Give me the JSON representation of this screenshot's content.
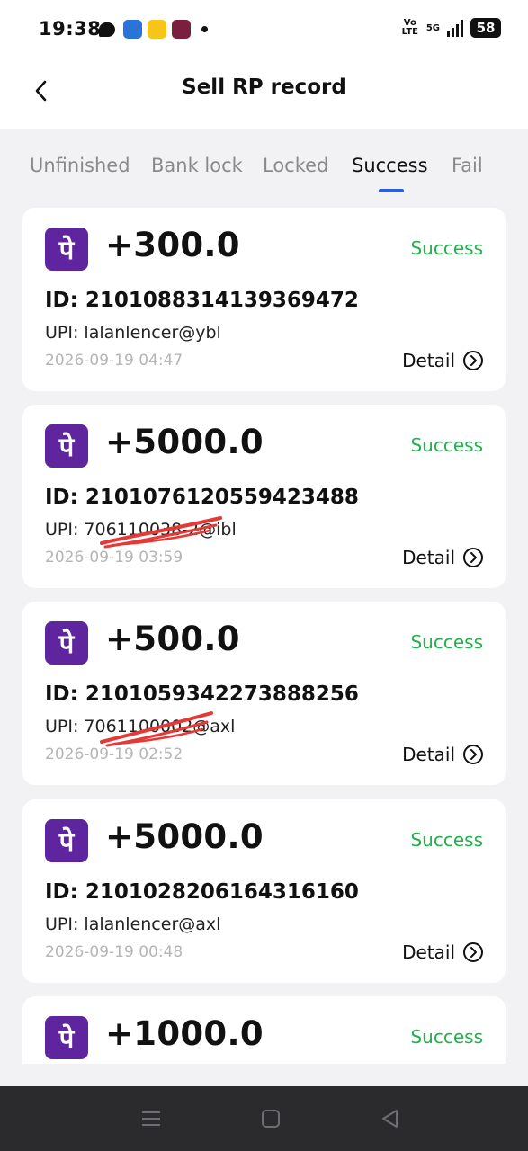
{
  "status_bar": {
    "time": "19:38",
    "network_label": "Vo LTE",
    "net_5g": "5G",
    "battery": "58"
  },
  "header": {
    "title": "Sell RP record"
  },
  "tabs": [
    {
      "label": "Unfinished",
      "active": false
    },
    {
      "label": "Bank lock",
      "active": false
    },
    {
      "label": "Locked",
      "active": false
    },
    {
      "label": "Success",
      "active": true
    },
    {
      "label": "Fail",
      "active": false
    }
  ],
  "colors": {
    "accent": "#2b5fd6",
    "success": "#22b14c",
    "phonepe": "#5f259f",
    "scribble": "#e53935"
  },
  "records": [
    {
      "icon": "phonepe-icon",
      "icon_glyph": "पे",
      "amount": "+300.0",
      "status": "Success",
      "id": "ID: 2101088314139369472",
      "upi": "UPI: lalanlencer@ybl",
      "date": "2026-09-19 04:47",
      "detail_label": "Detail",
      "redacted": false
    },
    {
      "icon": "phonepe-icon",
      "icon_glyph": "पे",
      "amount": "+5000.0",
      "status": "Success",
      "id": "ID: 2101076120559423488",
      "upi": "UPI: 706110038-2@ibl",
      "date": "2026-09-19 03:59",
      "detail_label": "Detail",
      "redacted": true
    },
    {
      "icon": "phonepe-icon",
      "icon_glyph": "पे",
      "amount": "+500.0",
      "status": "Success",
      "id": "ID: 2101059342273888256",
      "upi": "UPI: 7061100002@axl",
      "date": "2026-09-19 02:52",
      "detail_label": "Detail",
      "redacted": true
    },
    {
      "icon": "phonepe-icon",
      "icon_glyph": "पे",
      "amount": "+5000.0",
      "status": "Success",
      "id": "ID: 2101028206164316160",
      "upi": "UPI: lalanlencer@axl",
      "date": "2026-09-19 00:48",
      "detail_label": "Detail",
      "redacted": false
    },
    {
      "icon": "phonepe-icon",
      "icon_glyph": "पे",
      "amount": "+1000.0",
      "status": "Success",
      "id": "",
      "upi": "",
      "date": "",
      "detail_label": "",
      "redacted": false
    }
  ]
}
